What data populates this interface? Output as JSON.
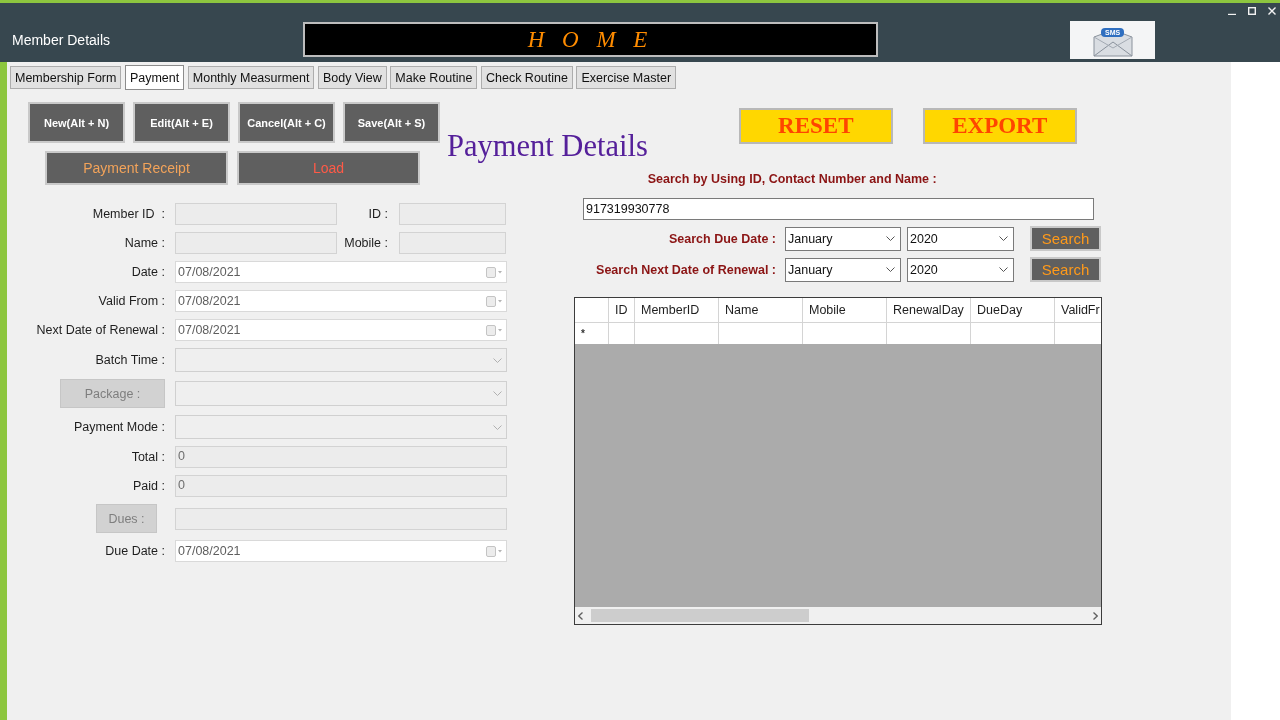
{
  "window": {
    "title": "Member Details",
    "banner": "H O M E",
    "logo_text": "SMS"
  },
  "tabs": [
    {
      "label": "Membership Form",
      "selected": false
    },
    {
      "label": "Payment",
      "selected": true
    },
    {
      "label": "Monthly Measurment",
      "selected": false
    },
    {
      "label": "Body View",
      "selected": false
    },
    {
      "label": "Make Routine",
      "selected": false
    },
    {
      "label": "Check Routine",
      "selected": false
    },
    {
      "label": "Exercise Master",
      "selected": false
    }
  ],
  "toolbar_rows": [
    [
      {
        "label": "New(Alt + N)",
        "kind": "command"
      },
      {
        "label": "Edit(Alt + E)",
        "kind": "command"
      },
      {
        "label": "Cancel(Alt + C)",
        "kind": "command"
      },
      {
        "label": "Save(Alt + S)",
        "kind": "command"
      }
    ],
    [
      {
        "label": "Payment Receipt",
        "kind": "receipt"
      },
      {
        "label": "Load",
        "kind": "load"
      }
    ]
  ],
  "heading": "Payment Details",
  "actions": [
    "RESET",
    "EXPORT"
  ],
  "form": [
    {
      "kind": "text_pair",
      "label": "Member ID  :",
      "label_button": false,
      "side_label": "ID :"
    },
    {
      "kind": "text_pair",
      "label": "Name :",
      "label_button": false,
      "side_label": "Mobile :"
    },
    {
      "kind": "date",
      "label": "Date :",
      "label_button": false,
      "value": "07/08/2021"
    },
    {
      "kind": "date",
      "label": "Valid From :",
      "label_button": false,
      "value": "07/08/2021"
    },
    {
      "kind": "date",
      "label": "Next Date of Renewal :",
      "label_button": false,
      "value": "07/08/2021"
    },
    {
      "kind": "combo",
      "label": "Batch Time :",
      "label_button": false
    },
    {
      "kind": "combo",
      "label": "Package :",
      "label_button": true,
      "disabled": true
    },
    {
      "kind": "combo",
      "label": "Payment Mode :",
      "label_button": false
    },
    {
      "kind": "text",
      "label": "Total :",
      "label_button": false,
      "value": "0"
    },
    {
      "kind": "text",
      "label": "Paid :",
      "label_button": false,
      "value": "0"
    },
    {
      "kind": "text",
      "label": "Dues :",
      "label_button": true,
      "disabled": true
    },
    {
      "kind": "date",
      "label": "Due Date :",
      "label_button": false,
      "value": "07/08/2021"
    }
  ],
  "search": {
    "label": "Search by Using ID, Contact Number and Name :",
    "value": "917319930778",
    "filters": [
      {
        "label": "Search Due Date :",
        "month": "January",
        "year": "2020",
        "button": "Search"
      },
      {
        "label": "Search Next Date of Renewal :",
        "month": "January",
        "year": "2020",
        "button": "Search"
      }
    ]
  },
  "table": {
    "columns": [
      "ID",
      "MemberID",
      "Name",
      "Mobile",
      "RenewalDay",
      "DueDay",
      "ValidFr"
    ],
    "new_row_marker": "*"
  }
}
